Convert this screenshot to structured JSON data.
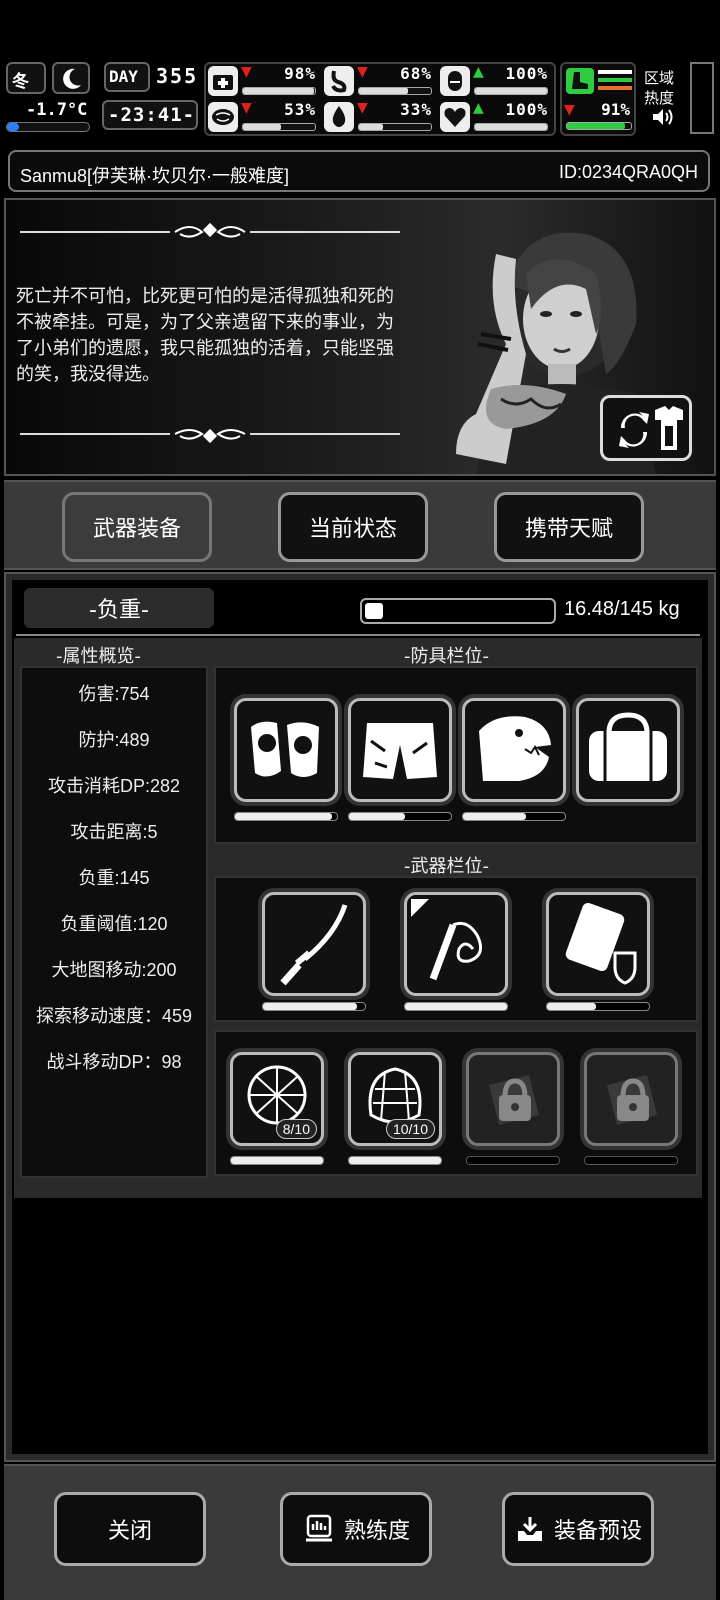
{
  "hud": {
    "season": "冬",
    "temperature": "-1.7°C",
    "day_label": "DAY",
    "day_number": "355",
    "clock": "-23:41-",
    "region_heat": "区域热度",
    "stats": [
      {
        "icon": "medkit-icon",
        "trend": "down",
        "value": "98%",
        "fill": 0.98
      },
      {
        "icon": "stomach-icon",
        "trend": "down",
        "value": "68%",
        "fill": 0.68
      },
      {
        "icon": "capsule-icon",
        "trend": "up",
        "value": "100%",
        "fill": 1.0
      },
      {
        "icon": "brain-icon",
        "trend": "down",
        "value": "53%",
        "fill": 0.53
      },
      {
        "icon": "water-drop-icon",
        "trend": "down",
        "value": "33%",
        "fill": 0.33
      },
      {
        "icon": "heart-icon",
        "trend": "up",
        "value": "100%",
        "fill": 1.0
      }
    ],
    "stamina": {
      "trend": "down",
      "value": "91%",
      "fill": 0.91
    }
  },
  "profile": {
    "name": "Sanmu8[伊芙琳·坎贝尔·一般难度]",
    "id": "ID:0234QRA0QH"
  },
  "banner": {
    "quote": "死亡并不可怕，比死更可怕的是活得孤独和死的不被牵挂。可是，为了父亲遗留下来的事业，为了小弟们的遗愿，我只能孤独的活着，只能坚强的笑，我没得选。"
  },
  "tabs": [
    {
      "label": "武器装备",
      "active": true
    },
    {
      "label": "当前状态",
      "active": false
    },
    {
      "label": "携带天赋",
      "active": false
    }
  ],
  "weight": {
    "label": "-负重-",
    "value": "16.48/145 kg",
    "fill": 0.11
  },
  "attributes": {
    "title": "-属性概览-",
    "rows": [
      "伤害:754",
      "防护:489",
      "攻击消耗DP:282",
      "攻击距离:5",
      "负重:145",
      "负重阈值:120",
      "大地图移动:200",
      "探索移动速度：459",
      "战斗移动DP：98"
    ]
  },
  "armor": {
    "title": "-防具栏位-",
    "slots": [
      {
        "icon": "knee-pads-icon",
        "durability": 0.95
      },
      {
        "icon": "shorts-icon",
        "durability": 0.55
      },
      {
        "icon": "dinosaur-head-icon",
        "durability": 0.62
      },
      {
        "icon": "duffel-bag-icon",
        "durability": null
      }
    ]
  },
  "weapons": {
    "title": "-武器栏位-",
    "slots": [
      {
        "icon": "katana-icon",
        "durability": 0.92
      },
      {
        "icon": "whip-icon",
        "durability": 1.0
      },
      {
        "icon": "shield-backpack-icon",
        "durability": 0.48
      }
    ]
  },
  "traps": [
    {
      "icon": "net-trap-icon",
      "count": "8/10",
      "durability": 1.0
    },
    {
      "icon": "net-bag-icon",
      "count": "10/10",
      "durability": 1.0
    },
    {
      "icon": "locked-slot-icon",
      "count": null,
      "durability": null
    },
    {
      "icon": "locked-slot-icon",
      "count": null,
      "durability": null
    }
  ],
  "footer": {
    "close": "关闭",
    "proficiency": "熟练度",
    "preset": "装备预设"
  }
}
